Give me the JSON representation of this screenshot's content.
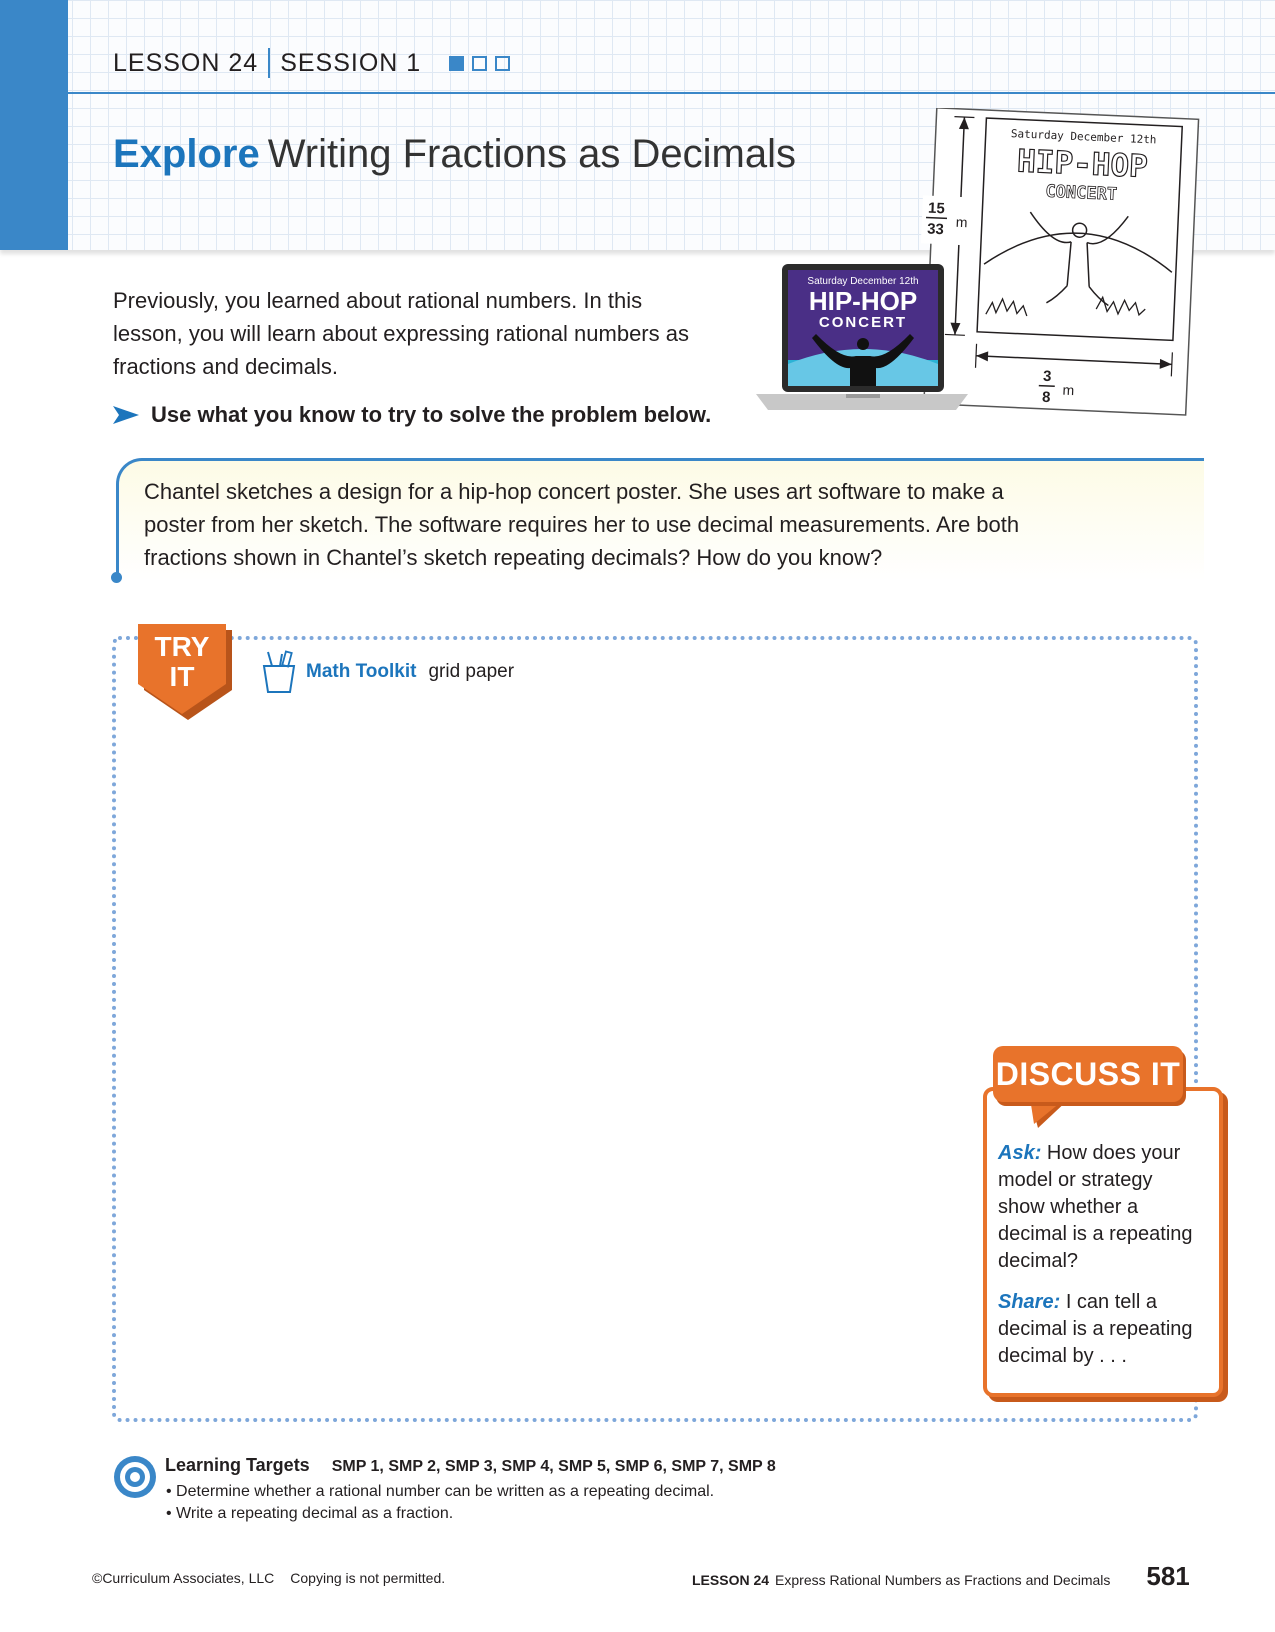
{
  "header": {
    "lesson": "LESSON 24",
    "session": "SESSION 1",
    "progress": {
      "completed": 1,
      "total": 3
    },
    "title_keyword": "Explore",
    "title_rest": "Writing Fractions as Decimals"
  },
  "intro": {
    "text": "Previously, you learned about rational numbers. In this lesson, you will learn about expressing rational numbers as fractions and decimals.",
    "prompt": "Use what you know to try to solve the problem below."
  },
  "illustration": {
    "laptop_date": "Saturday December 12th",
    "laptop_title": "HIP-HOP",
    "laptop_subtitle": "CONCERT",
    "sketch_date": "Saturday December 12th",
    "sketch_title": "HIP-HOP",
    "sketch_subtitle": "CONCERT",
    "height_num": "15",
    "height_den": "33",
    "height_unit": "m",
    "width_num": "3",
    "width_den": "8",
    "width_unit": "m"
  },
  "problem": {
    "text": "Chantel sketches a design for a hip-hop concert poster. She uses art software to make a poster from her sketch. The software requires her to use decimal measurements. Are both fractions shown in Chantel’s sketch repeating decimals? How do you know?"
  },
  "try_it": {
    "badge_line1": "TRY",
    "badge_line2": "IT",
    "toolkit_label": "Math Toolkit",
    "toolkit_items": "grid paper"
  },
  "discuss": {
    "banner": "DISCUSS IT",
    "ask_label": "Ask:",
    "ask_text": "How does your model or strategy show whether a decimal is a repeating decimal?",
    "share_label": "Share:",
    "share_text": "I can tell a decimal is a repeating decimal by . . ."
  },
  "learning_targets": {
    "title": "Learning Targets",
    "smp": "SMP 1, SMP 2, SMP 3, SMP 4, SMP 5, SMP 6, SMP 7, SMP 8",
    "items": [
      "Determine whether a rational number can be written as a repeating decimal.",
      "Write a repeating decimal as a fraction."
    ]
  },
  "footer": {
    "copyright": "©Curriculum Associates, LLC",
    "notice": "Copying is not permitted.",
    "lesson_label": "LESSON 24",
    "lesson_title": "Express Rational Numbers as Fractions and Decimals",
    "page": "581"
  },
  "colors": {
    "accent_blue": "#1c75bc",
    "strip_blue": "#3a87c8",
    "orange": "#e8732b",
    "laptop_screen": "#5b3a8c"
  }
}
